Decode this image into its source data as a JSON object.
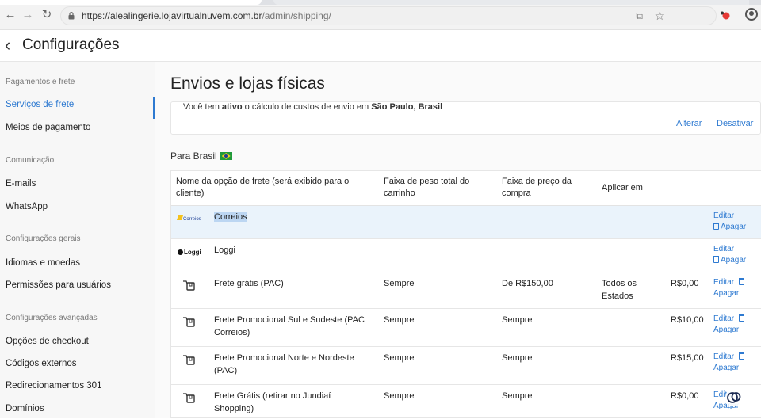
{
  "browser": {
    "url_domain": "https://alealingerie.lojavirtualnuvem.com.br",
    "url_path": "/admin/shipping/"
  },
  "header": {
    "title": "Configurações"
  },
  "sidebar": {
    "sections": [
      {
        "label": "Pagamentos e frete",
        "items": [
          "Serviços de frete",
          "Meios de pagamento"
        ]
      },
      {
        "label": "Comunicação",
        "items": [
          "E-mails",
          "WhatsApp"
        ]
      },
      {
        "label": "Configurações gerais",
        "items": [
          "Idiomas e moedas",
          "Permissões para usuários"
        ]
      },
      {
        "label": "Configurações avançadas",
        "items": [
          "Opções de checkout",
          "Códigos externos",
          "Redirecionamentos 301",
          "Domínios"
        ]
      }
    ],
    "active_item": "Serviços de frete"
  },
  "main": {
    "title": "Envios e lojas físicas",
    "info": {
      "prefix": "Você tem",
      "status": "ativo",
      "middle": "o cálculo de custos de envio em",
      "location": "São Paulo, Brasil",
      "alterar": "Alterar",
      "desativar": "Desativar"
    },
    "country_label": "Para Brasil",
    "table": {
      "headers": {
        "name": "Nome da opção de frete (será exibido para o cliente)",
        "weight": "Faixa de peso total do carrinho",
        "price": "Faixa de preço da compra",
        "apply": "Aplicar em"
      },
      "edit_label": "Editar",
      "delete_label": "Apagar",
      "rows": [
        {
          "logo": "Correios",
          "name": "Correios"
        },
        {
          "logo": "Loggi",
          "name": "Loggi"
        },
        {
          "name": "Frete grátis (PAC)",
          "weight": "Sempre",
          "price": "De R$150,00",
          "apply": "Todos os Estados",
          "cost": "R$0,00"
        },
        {
          "name": "Frete Promocional Sul e Sudeste (PAC Correios)",
          "weight": "Sempre",
          "price": "Sempre",
          "cost": "R$10,00"
        },
        {
          "name": "Frete Promocional Norte e Nordeste (PAC)",
          "weight": "Sempre",
          "price": "Sempre",
          "cost": "R$15,00"
        },
        {
          "name": "Frete Grátis (retirar no Jundiaí Shopping)",
          "weight": "Sempre",
          "price": "Sempre",
          "cost": "R$0,00"
        }
      ]
    }
  }
}
